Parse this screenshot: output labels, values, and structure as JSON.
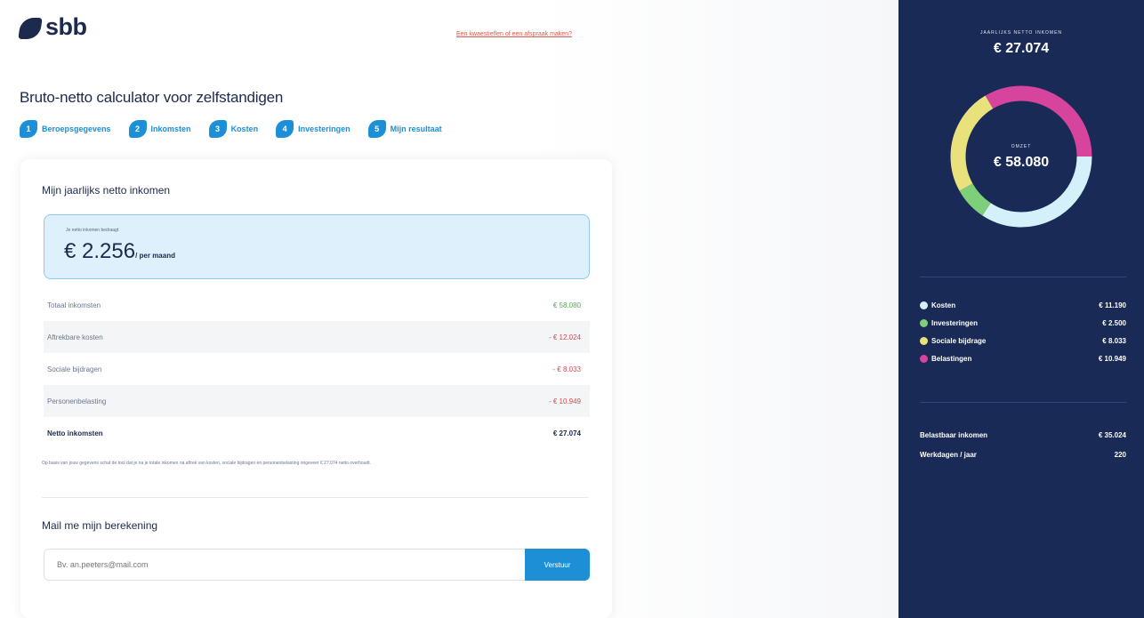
{
  "header": {
    "logo_text": "sbb",
    "help_link": "Een kwaestieflen of een afspraak maken?"
  },
  "page_title": "Bruto-netto calculator voor zelfstandigen",
  "steps": [
    {
      "number": "1",
      "label": "Beroepsgegevens"
    },
    {
      "number": "2",
      "label": "Inkomsten"
    },
    {
      "number": "3",
      "label": "Kosten"
    },
    {
      "number": "4",
      "label": "Investeringen"
    },
    {
      "number": "5",
      "label": "Mijn resultaat"
    }
  ],
  "result": {
    "card_title": "Mijn jaarlijks netto inkomen",
    "highlight_label": "Je netto inkomen bedraagt",
    "monthly_amount": "€ 2.256",
    "monthly_suffix": "/ per maand",
    "rows": [
      {
        "label": "Totaal inkomsten",
        "value": "€ 58.080",
        "tone": "green"
      },
      {
        "label": "Aftrekbare kosten",
        "value": "- € 12.024",
        "tone": "red"
      },
      {
        "label": "Sociale bijdragen",
        "value": "- € 8.033",
        "tone": "red"
      },
      {
        "label": "Personenbelasting",
        "value": "- € 10.949",
        "tone": "red"
      }
    ],
    "total": {
      "label": "Netto inkomsten",
      "value": "€ 27.074"
    },
    "note": "Op basis van jouw gegevens schat de tool dat je na je totale inkomen na aftrek van kosten, sociale bijdragen en personenbelasting ongeveer € 27.074 netto overhoudt."
  },
  "mail": {
    "title": "Mail me mijn berekening",
    "placeholder": "Bv. an.peeters@mail.com",
    "button": "Verstuur"
  },
  "sidebar": {
    "top_label": "JAARLIJKS NETTO INKOMEN",
    "top_value": "€ 27.074",
    "donut_label": "OMZET",
    "donut_value": "€ 58.080",
    "legend": [
      {
        "label": "Kosten",
        "value": "€ 11.190",
        "color": "#d4f1fb"
      },
      {
        "label": "Investeringen",
        "value": "€ 2.500",
        "color": "#7fcf7a"
      },
      {
        "label": "Sociale bijdrage",
        "value": "€ 8.033",
        "color": "#e9e27c"
      },
      {
        "label": "Belastingen",
        "value": "€ 10.949",
        "color": "#d6449e"
      }
    ],
    "meta": [
      {
        "label": "Belastbaar inkomen",
        "value": "€ 35.024"
      },
      {
        "label": "Werkdagen / jaar",
        "value": "220"
      }
    ]
  },
  "colors": {
    "brand_navy": "#182a55",
    "brand_blue": "#1d8fd6",
    "highlight_bg": "#ddf0fb"
  }
}
